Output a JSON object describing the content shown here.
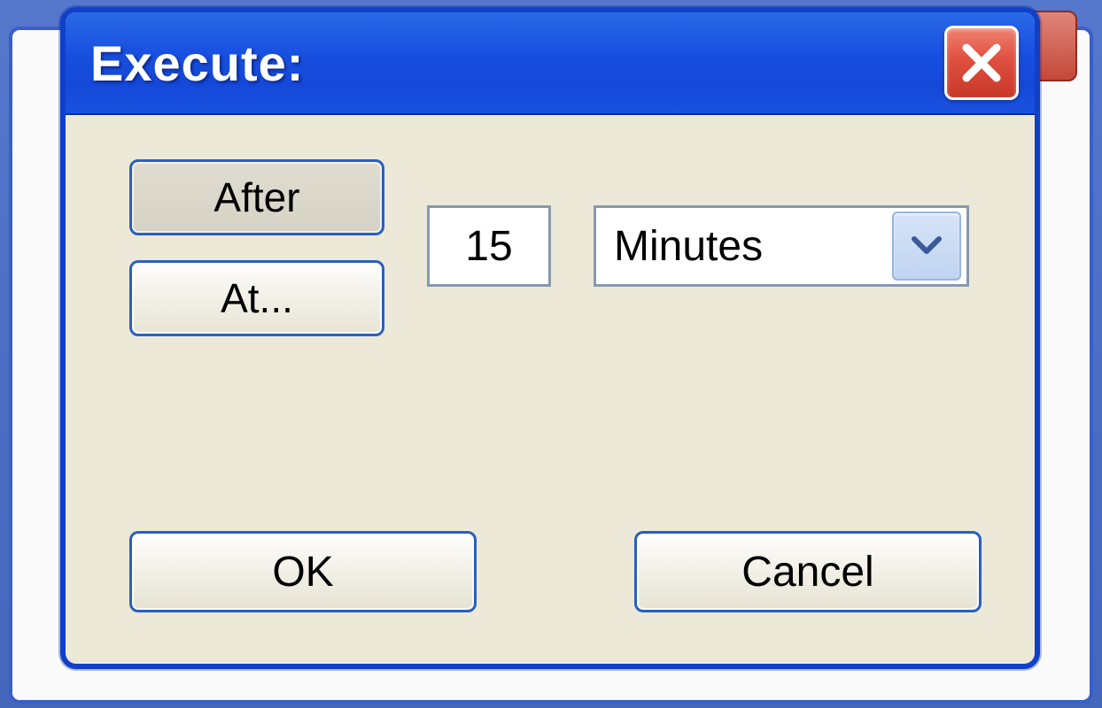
{
  "dialog": {
    "title": "Execute:",
    "mode_buttons": {
      "after": "After",
      "at": "At..."
    },
    "value": "15",
    "unit_selected": "Minutes",
    "actions": {
      "ok": "OK",
      "cancel": "Cancel"
    }
  }
}
